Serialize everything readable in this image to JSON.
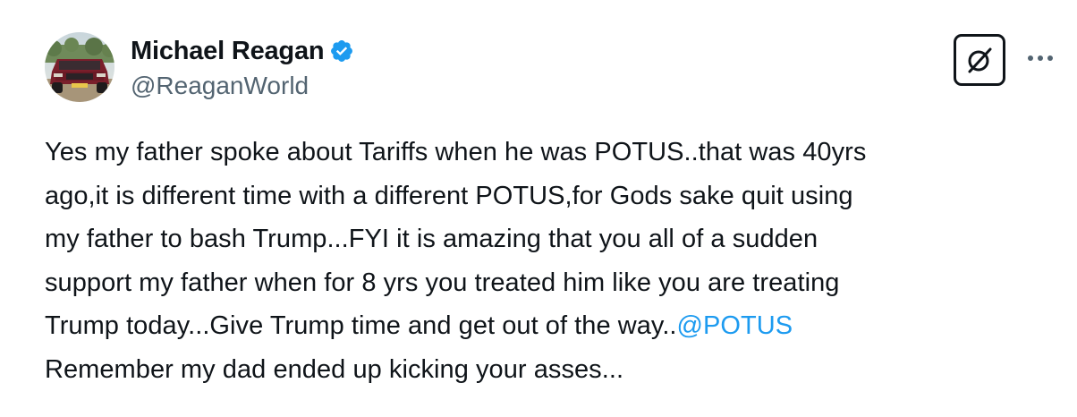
{
  "tweet": {
    "author": {
      "display_name": "Michael Reagan",
      "handle": "@ReaganWorld",
      "verified_icon": "verified-badge-icon",
      "avatar_icon": "avatar-red-truck"
    },
    "actions": {
      "grok_icon": "grok-icon",
      "more_icon": "more-options-icon",
      "more_label": "···"
    },
    "text_lines": [
      {
        "text": "Yes my father spoke about Tariffs when he was POTUS..that was 40yrs",
        "mention": "",
        "after": ""
      },
      {
        "text": "ago,it is different time with a different POTUS,for Gods sake quit using",
        "mention": "",
        "after": ""
      },
      {
        "text": "my father to bash Trump...FYI it is amazing that you all of a sudden",
        "mention": "",
        "after": ""
      },
      {
        "text": "support my father when for 8 yrs you treated him like you are treating",
        "mention": "",
        "after": ""
      },
      {
        "text": "Trump today...Give Trump time and get out of the way..",
        "mention": "@POTUS",
        "after": ""
      },
      {
        "text": "Remember my dad ended up kicking your asses...",
        "mention": "",
        "after": ""
      }
    ],
    "colors": {
      "text": "#0f1419",
      "secondary": "#536471",
      "accent": "#1d9bf0"
    }
  }
}
